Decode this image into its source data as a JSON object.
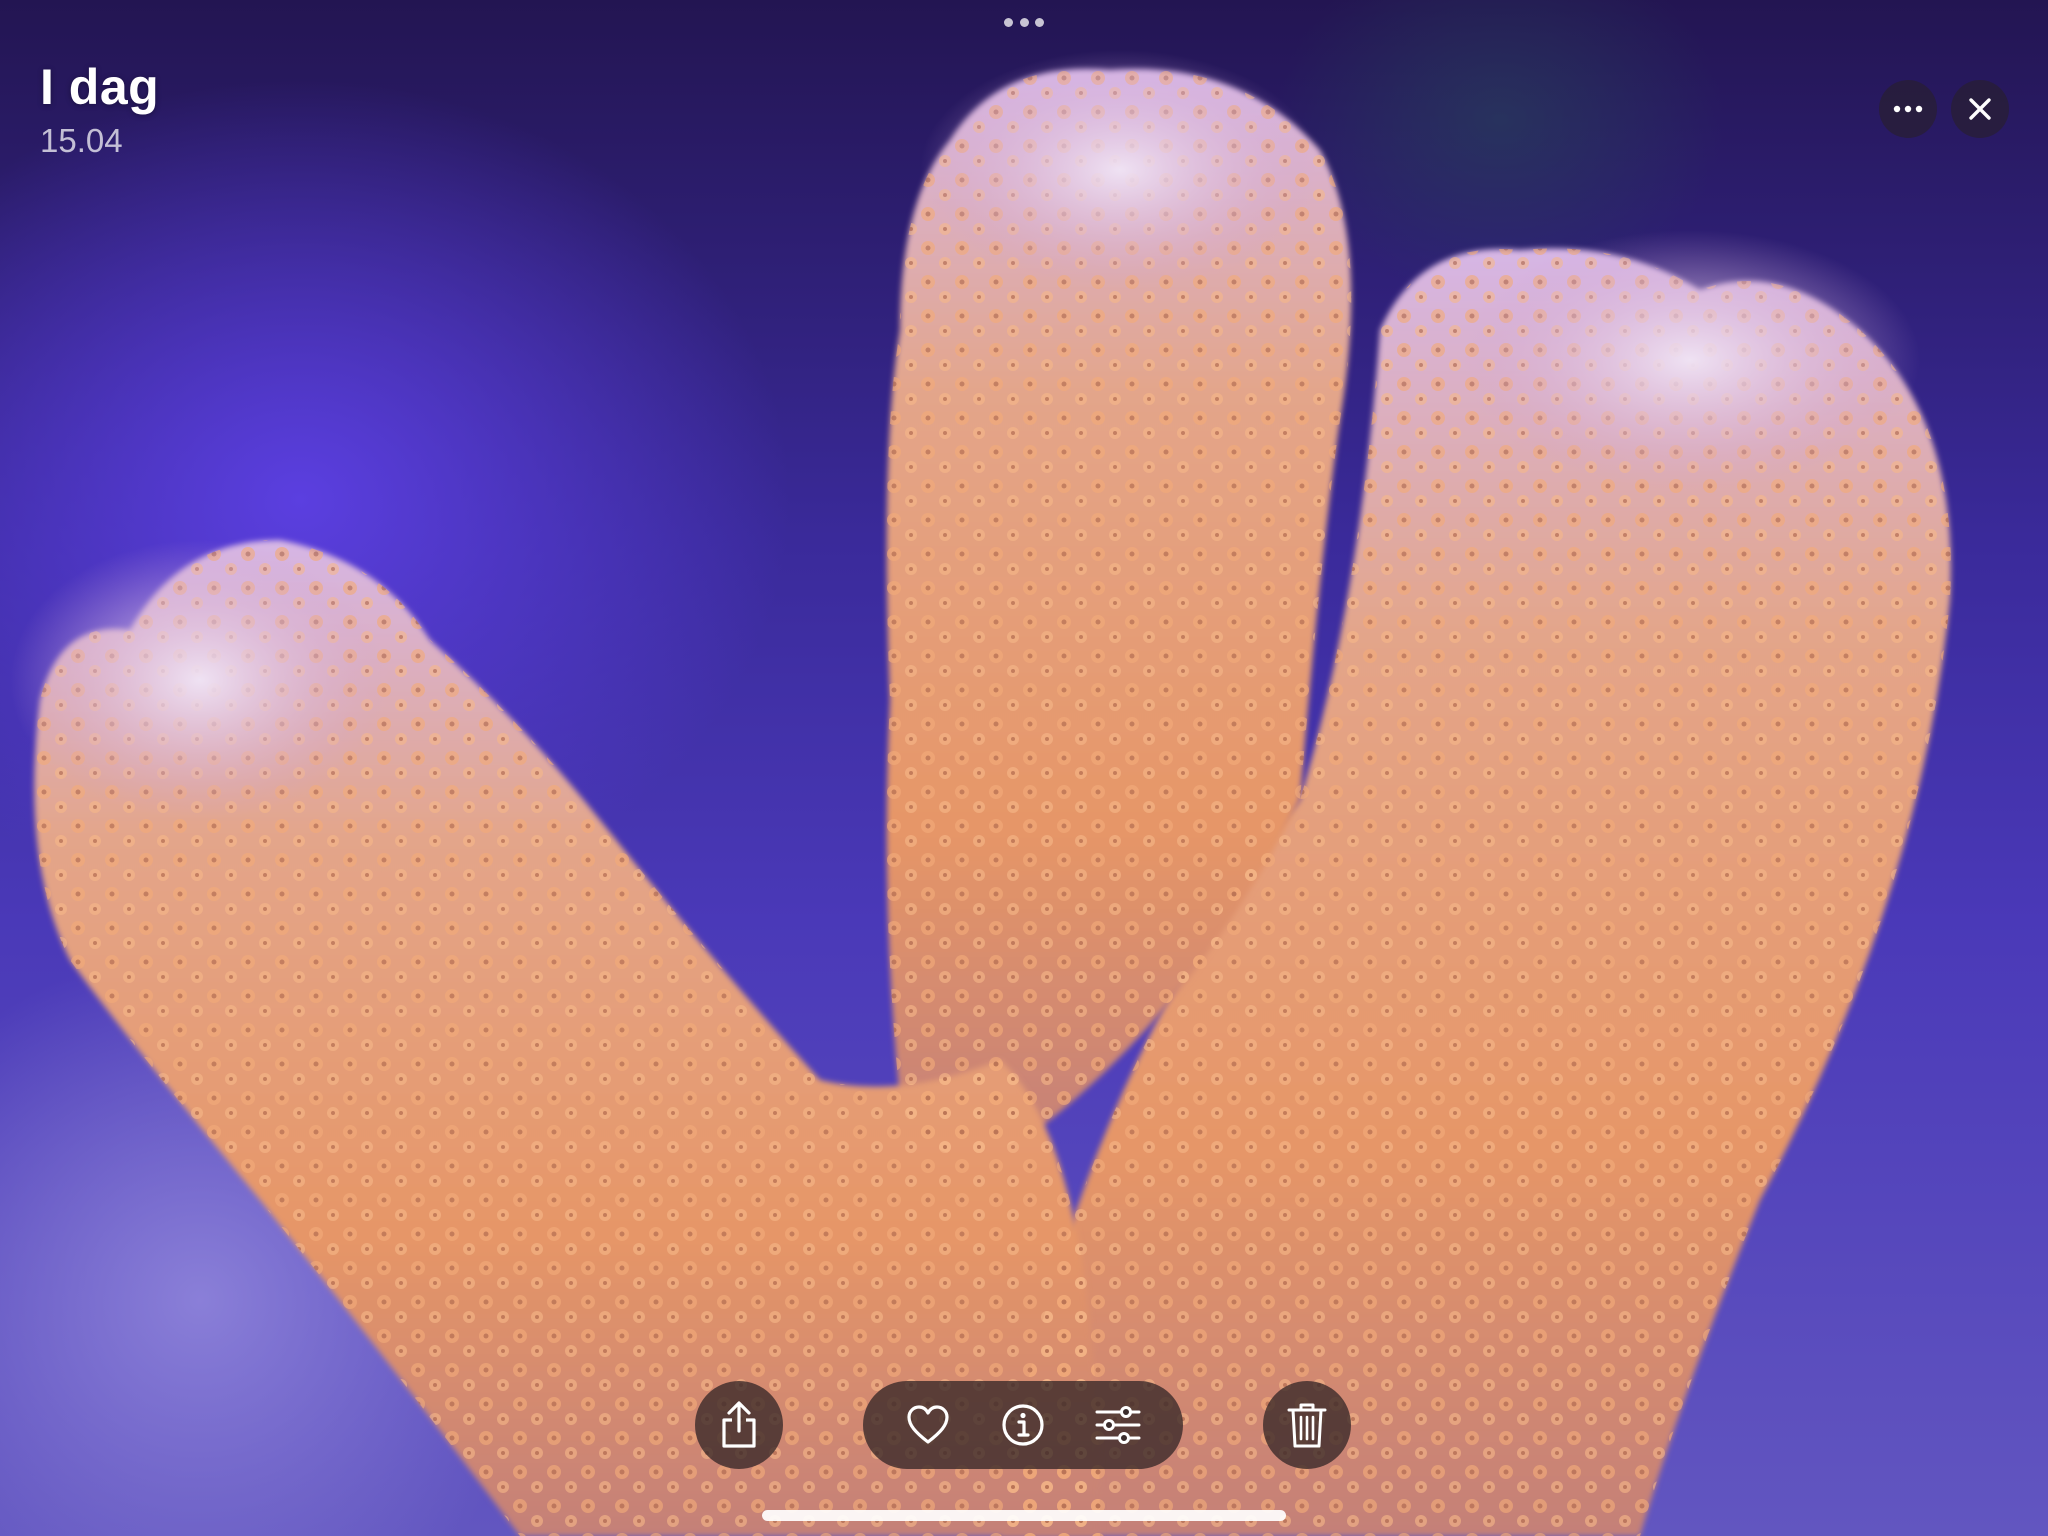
{
  "header": {
    "title": "I dag",
    "date": "15.04"
  },
  "top_handle": {
    "icon": "ellipsis-handle-icon"
  },
  "actions": {
    "more_icon": "ellipsis-icon",
    "close_icon": "close-icon"
  },
  "toolbar": {
    "share_icon": "share-icon",
    "favorite_icon": "heart-icon",
    "info_icon": "info-icon",
    "edit_icon": "sliders-icon",
    "delete_icon": "trash-icon"
  },
  "photo": {
    "subject_colors": {
      "background": "#4a39b8",
      "coral_body": "#e49a6f",
      "coral_tip": "#d9b9e6",
      "polyp": "#f1a874"
    }
  }
}
